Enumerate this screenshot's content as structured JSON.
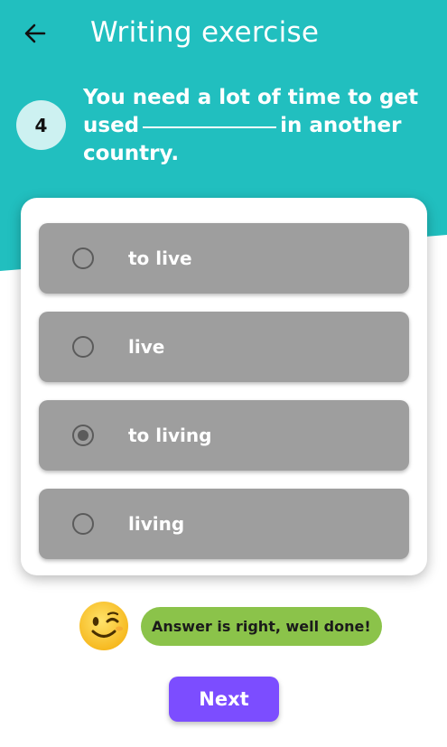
{
  "header": {
    "title": "Writing exercise",
    "back_icon": "arrow-left-icon"
  },
  "question": {
    "number": "4",
    "text_before": "You need a lot of time to get used",
    "text_after": "in another country."
  },
  "options": [
    {
      "label": "to live",
      "selected": false
    },
    {
      "label": "live",
      "selected": false
    },
    {
      "label": "to living",
      "selected": true
    },
    {
      "label": "living",
      "selected": false
    }
  ],
  "feedback": {
    "emoji": "winking-face-icon",
    "message": "Answer is right, well done!"
  },
  "next_button": {
    "label": "Next"
  },
  "colors": {
    "header_teal": "#21bfbf",
    "option_gray": "#9e9e9e",
    "feedback_green": "#8bc34a",
    "next_purple": "#7c4dff"
  }
}
